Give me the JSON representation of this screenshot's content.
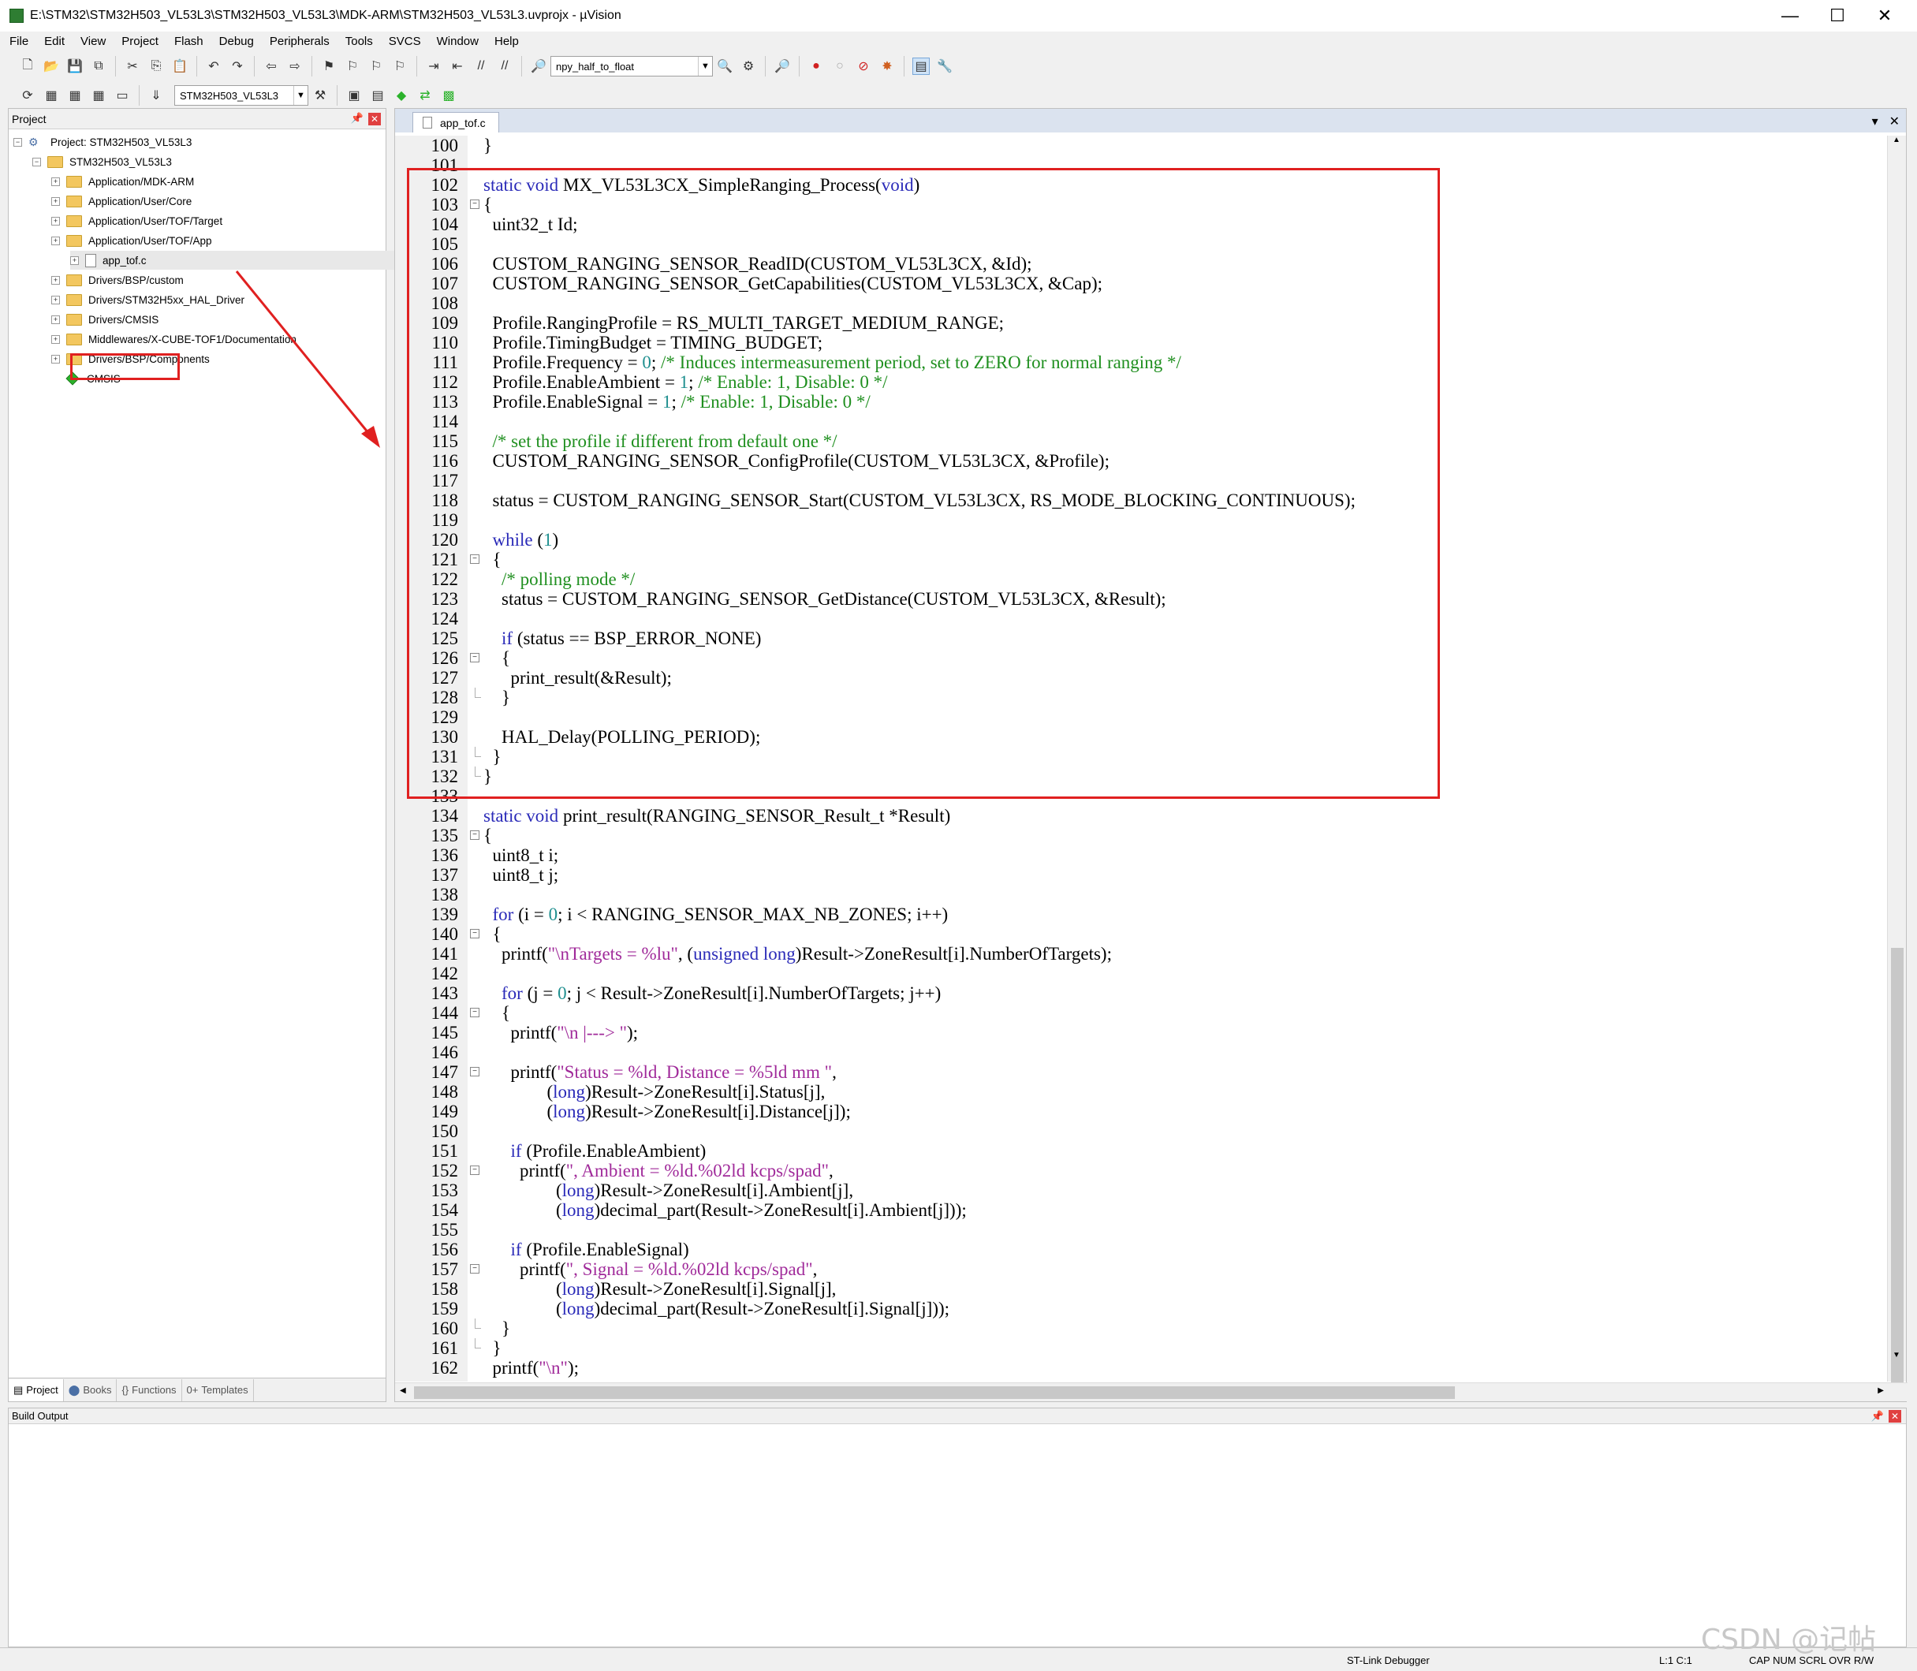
{
  "window": {
    "title": "E:\\STM32\\STM32H503_VL53L3\\STM32H503_VL53L3\\MDK-ARM\\STM32H503_VL53L3.uvprojx - µVision",
    "minimize": "—",
    "maximize": "☐",
    "close": "✕"
  },
  "menu": [
    "File",
    "Edit",
    "View",
    "Project",
    "Flash",
    "Debug",
    "Peripherals",
    "Tools",
    "SVCS",
    "Window",
    "Help"
  ],
  "toolbar": {
    "find_combo": "npy_half_to_float",
    "target_combo": "STM32H503_VL53L3"
  },
  "project_pane": {
    "title": "Project",
    "tree": [
      {
        "label": "Project: STM32H503_VL53L3",
        "indent": 0,
        "type": "project"
      },
      {
        "label": "STM32H503_VL53L3",
        "indent": 1,
        "type": "target"
      },
      {
        "label": "Application/MDK-ARM",
        "indent": 2,
        "type": "folder"
      },
      {
        "label": "Application/User/Core",
        "indent": 2,
        "type": "folder"
      },
      {
        "label": "Application/User/TOF/Target",
        "indent": 2,
        "type": "folder"
      },
      {
        "label": "Application/User/TOF/App",
        "indent": 2,
        "type": "folder"
      },
      {
        "label": "app_tof.c",
        "indent": 3,
        "type": "file"
      },
      {
        "label": "Drivers/BSP/custom",
        "indent": 2,
        "type": "folder"
      },
      {
        "label": "Drivers/STM32H5xx_HAL_Driver",
        "indent": 2,
        "type": "folder"
      },
      {
        "label": "Drivers/CMSIS",
        "indent": 2,
        "type": "folder"
      },
      {
        "label": "Middlewares/X-CUBE-TOF1/Documentation",
        "indent": 2,
        "type": "folder"
      },
      {
        "label": "Drivers/BSP/Components",
        "indent": 2,
        "type": "folder"
      },
      {
        "label": "CMSIS",
        "indent": 2,
        "type": "cmsis"
      }
    ],
    "tabs": [
      "Project",
      "Books",
      "Functions",
      "Templates"
    ]
  },
  "editor": {
    "tab": "app_tof.c",
    "lines": [
      {
        "n": "100",
        "html": "}"
      },
      {
        "n": "101",
        "html": ""
      },
      {
        "n": "102",
        "html": "<span class=\"kw\">static void</span> MX_VL53L3CX_SimpleRanging_Process(<span class=\"kw\">void</span>)"
      },
      {
        "n": "103",
        "html": "{",
        "fold": "open"
      },
      {
        "n": "104",
        "html": "  uint32_t Id;"
      },
      {
        "n": "105",
        "html": ""
      },
      {
        "n": "106",
        "html": "  CUSTOM_RANGING_SENSOR_ReadID(CUSTOM_VL53L3CX, &amp;Id);"
      },
      {
        "n": "107",
        "html": "  CUSTOM_RANGING_SENSOR_GetCapabilities(CUSTOM_VL53L3CX, &amp;Cap);"
      },
      {
        "n": "108",
        "html": ""
      },
      {
        "n": "109",
        "html": "  Profile.RangingProfile = RS_MULTI_TARGET_MEDIUM_RANGE;"
      },
      {
        "n": "110",
        "html": "  Profile.TimingBudget = TIMING_BUDGET;"
      },
      {
        "n": "111",
        "html": "  Profile.Frequency = <span class=\"nm\">0</span>; <span class=\"cm\">/* Induces intermeasurement period, set to ZERO for normal ranging */</span>"
      },
      {
        "n": "112",
        "html": "  Profile.EnableAmbient = <span class=\"nm\">1</span>; <span class=\"cm\">/* Enable: 1, Disable: 0 */</span>"
      },
      {
        "n": "113",
        "html": "  Profile.EnableSignal = <span class=\"nm\">1</span>; <span class=\"cm\">/* Enable: 1, Disable: 0 */</span>"
      },
      {
        "n": "114",
        "html": ""
      },
      {
        "n": "115",
        "html": "  <span class=\"cm\">/* set the profile if different from default one */</span>"
      },
      {
        "n": "116",
        "html": "  CUSTOM_RANGING_SENSOR_ConfigProfile(CUSTOM_VL53L3CX, &amp;Profile);"
      },
      {
        "n": "117",
        "html": ""
      },
      {
        "n": "118",
        "html": "  status = CUSTOM_RANGING_SENSOR_Start(CUSTOM_VL53L3CX, RS_MODE_BLOCKING_CONTINUOUS);"
      },
      {
        "n": "119",
        "html": ""
      },
      {
        "n": "120",
        "html": "  <span class=\"kw\">while</span> (<span class=\"nm\">1</span>)"
      },
      {
        "n": "121",
        "html": "  {",
        "fold": "open"
      },
      {
        "n": "122",
        "html": "    <span class=\"cm\">/* polling mode */</span>"
      },
      {
        "n": "123",
        "html": "    status = CUSTOM_RANGING_SENSOR_GetDistance(CUSTOM_VL53L3CX, &amp;Result);"
      },
      {
        "n": "124",
        "html": ""
      },
      {
        "n": "125",
        "html": "    <span class=\"kw\">if</span> (status == BSP_ERROR_NONE)"
      },
      {
        "n": "126",
        "html": "    {",
        "fold": "open"
      },
      {
        "n": "127",
        "html": "      print_result(&amp;Result);"
      },
      {
        "n": "128",
        "html": "    }",
        "fold": "end"
      },
      {
        "n": "129",
        "html": ""
      },
      {
        "n": "130",
        "html": "    HAL_Delay(POLLING_PERIOD);"
      },
      {
        "n": "131",
        "html": "  }",
        "fold": "end"
      },
      {
        "n": "132",
        "html": "}",
        "fold": "end"
      },
      {
        "n": "133",
        "html": ""
      },
      {
        "n": "134",
        "html": "<span class=\"kw\">static void</span> print_result(RANGING_SENSOR_Result_t *Result)"
      },
      {
        "n": "135",
        "html": "{",
        "fold": "open"
      },
      {
        "n": "136",
        "html": "  uint8_t i;"
      },
      {
        "n": "137",
        "html": "  uint8_t j;"
      },
      {
        "n": "138",
        "html": ""
      },
      {
        "n": "139",
        "html": "  <span class=\"kw\">for</span> (i = <span class=\"nm\">0</span>; i &lt; RANGING_SENSOR_MAX_NB_ZONES; i++)"
      },
      {
        "n": "140",
        "html": "  {",
        "fold": "open"
      },
      {
        "n": "141",
        "html": "    printf(<span class=\"st\">\"\\nTargets = %lu\"</span>, (<span class=\"kw\">unsigned long</span>)Result-&gt;ZoneResult[i].NumberOfTargets);"
      },
      {
        "n": "142",
        "html": ""
      },
      {
        "n": "143",
        "html": "    <span class=\"kw\">for</span> (j = <span class=\"nm\">0</span>; j &lt; Result-&gt;ZoneResult[i].NumberOfTargets; j++)"
      },
      {
        "n": "144",
        "html": "    {",
        "fold": "open"
      },
      {
        "n": "145",
        "html": "      printf(<span class=\"st\">\"\\n |---&gt; \"</span>);"
      },
      {
        "n": "146",
        "html": ""
      },
      {
        "n": "147",
        "html": "      printf(<span class=\"st\">\"Status = %ld, Distance = %5ld mm \"</span>,",
        "fold": "open"
      },
      {
        "n": "148",
        "html": "              (<span class=\"kw\">long</span>)Result-&gt;ZoneResult[i].Status[j],"
      },
      {
        "n": "149",
        "html": "              (<span class=\"kw\">long</span>)Result-&gt;ZoneResult[i].Distance[j]);"
      },
      {
        "n": "150",
        "html": ""
      },
      {
        "n": "151",
        "html": "      <span class=\"kw\">if</span> (Profile.EnableAmbient)"
      },
      {
        "n": "152",
        "html": "        printf(<span class=\"st\">\", Ambient = %ld.%02ld kcps/spad\"</span>,",
        "fold": "open"
      },
      {
        "n": "153",
        "html": "                (<span class=\"kw\">long</span>)Result-&gt;ZoneResult[i].Ambient[j],"
      },
      {
        "n": "154",
        "html": "                (<span class=\"kw\">long</span>)decimal_part(Result-&gt;ZoneResult[i].Ambient[j]));"
      },
      {
        "n": "155",
        "html": ""
      },
      {
        "n": "156",
        "html": "      <span class=\"kw\">if</span> (Profile.EnableSignal)"
      },
      {
        "n": "157",
        "html": "        printf(<span class=\"st\">\", Signal = %ld.%02ld kcps/spad\"</span>,",
        "fold": "open"
      },
      {
        "n": "158",
        "html": "                (<span class=\"kw\">long</span>)Result-&gt;ZoneResult[i].Signal[j],"
      },
      {
        "n": "159",
        "html": "                (<span class=\"kw\">long</span>)decimal_part(Result-&gt;ZoneResult[i].Signal[j]));"
      },
      {
        "n": "160",
        "html": "    }",
        "fold": "end"
      },
      {
        "n": "161",
        "html": "  }",
        "fold": "end"
      },
      {
        "n": "162",
        "html": "  printf(<span class=\"st\">\"\\n\"</span>);"
      }
    ]
  },
  "build_output": {
    "title": "Build Output"
  },
  "statusbar": {
    "debugger": "ST-Link Debugger",
    "cursor": "L:1 C:1",
    "flags": "CAP  NUM  SCRL  OVR  R/W"
  },
  "watermark": "CSDN @记帖",
  "colors": {
    "highlight_box": "#e02020",
    "keyword": "#2a2ab8",
    "comment": "#1f8f1f",
    "string": "#a02a9a",
    "number": "#1f8f8f"
  }
}
